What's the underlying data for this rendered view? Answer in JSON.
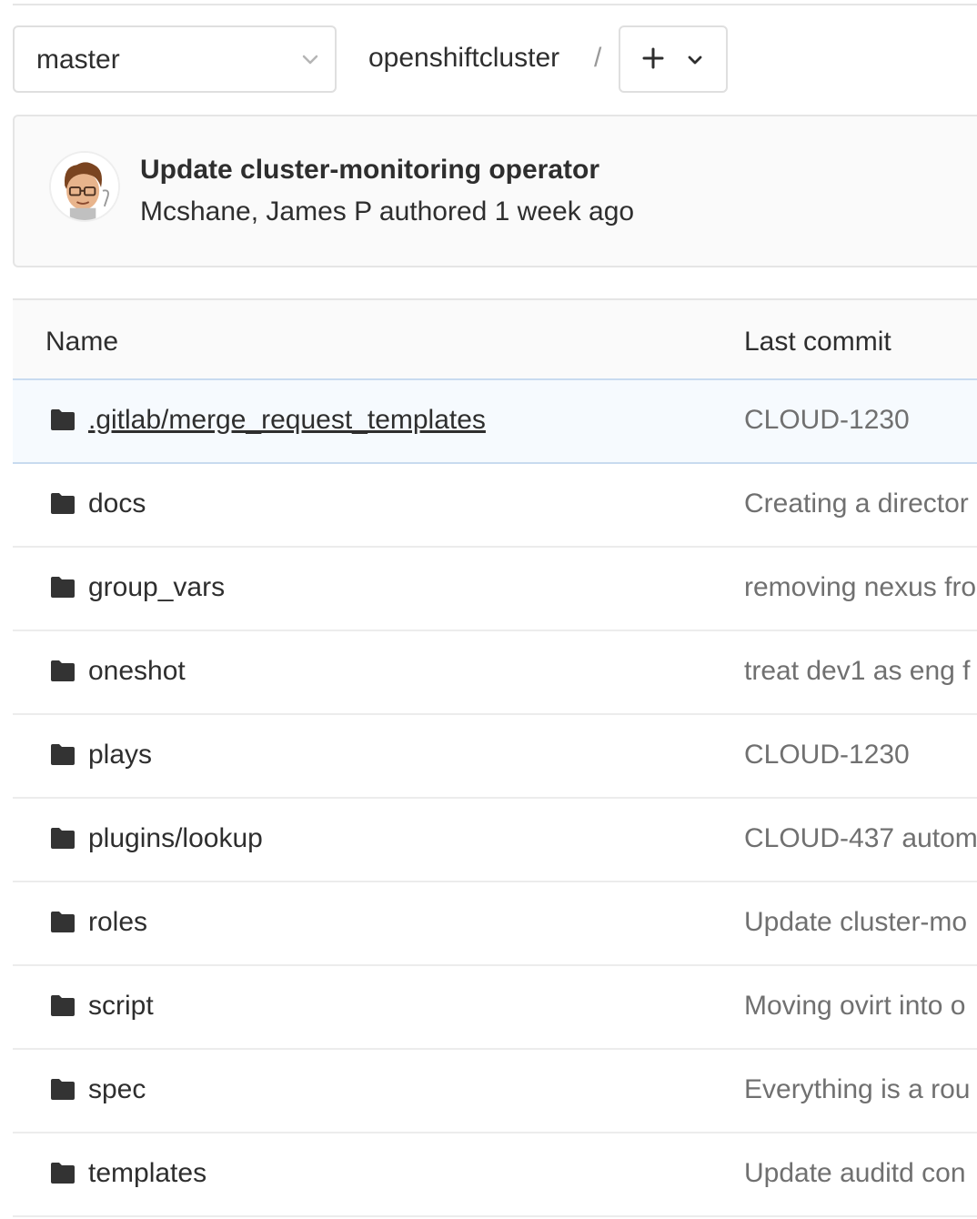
{
  "toolbar": {
    "branch": "master",
    "path": "openshiftcluster",
    "separator": "/",
    "add_icon": "plus-icon",
    "dropdown_icon": "chevron-down-icon"
  },
  "last_commit": {
    "title": "Update cluster-monitoring operator",
    "meta": "Mcshane, James P authored 1 week ago",
    "avatar_icon": "avatar-cartoon"
  },
  "table": {
    "headers": {
      "name": "Name",
      "last_commit": "Last commit"
    },
    "rows": [
      {
        "name": ".gitlab/merge_request_templates",
        "commit": "CLOUD-1230"
      },
      {
        "name": "docs",
        "commit": "Creating a director"
      },
      {
        "name": "group_vars",
        "commit": "removing nexus fro"
      },
      {
        "name": "oneshot",
        "commit": "treat dev1 as eng f"
      },
      {
        "name": "plays",
        "commit": "CLOUD-1230"
      },
      {
        "name": "plugins/lookup",
        "commit": "CLOUD-437 autom"
      },
      {
        "name": "roles",
        "commit": "Update cluster-mo"
      },
      {
        "name": "script",
        "commit": "Moving ovirt into o"
      },
      {
        "name": "spec",
        "commit": "Everything is a rou"
      },
      {
        "name": "templates",
        "commit": "Update auditd con"
      }
    ]
  },
  "colors": {
    "selected_row_bg": "#f6fafe",
    "commit_text": "#707070"
  }
}
